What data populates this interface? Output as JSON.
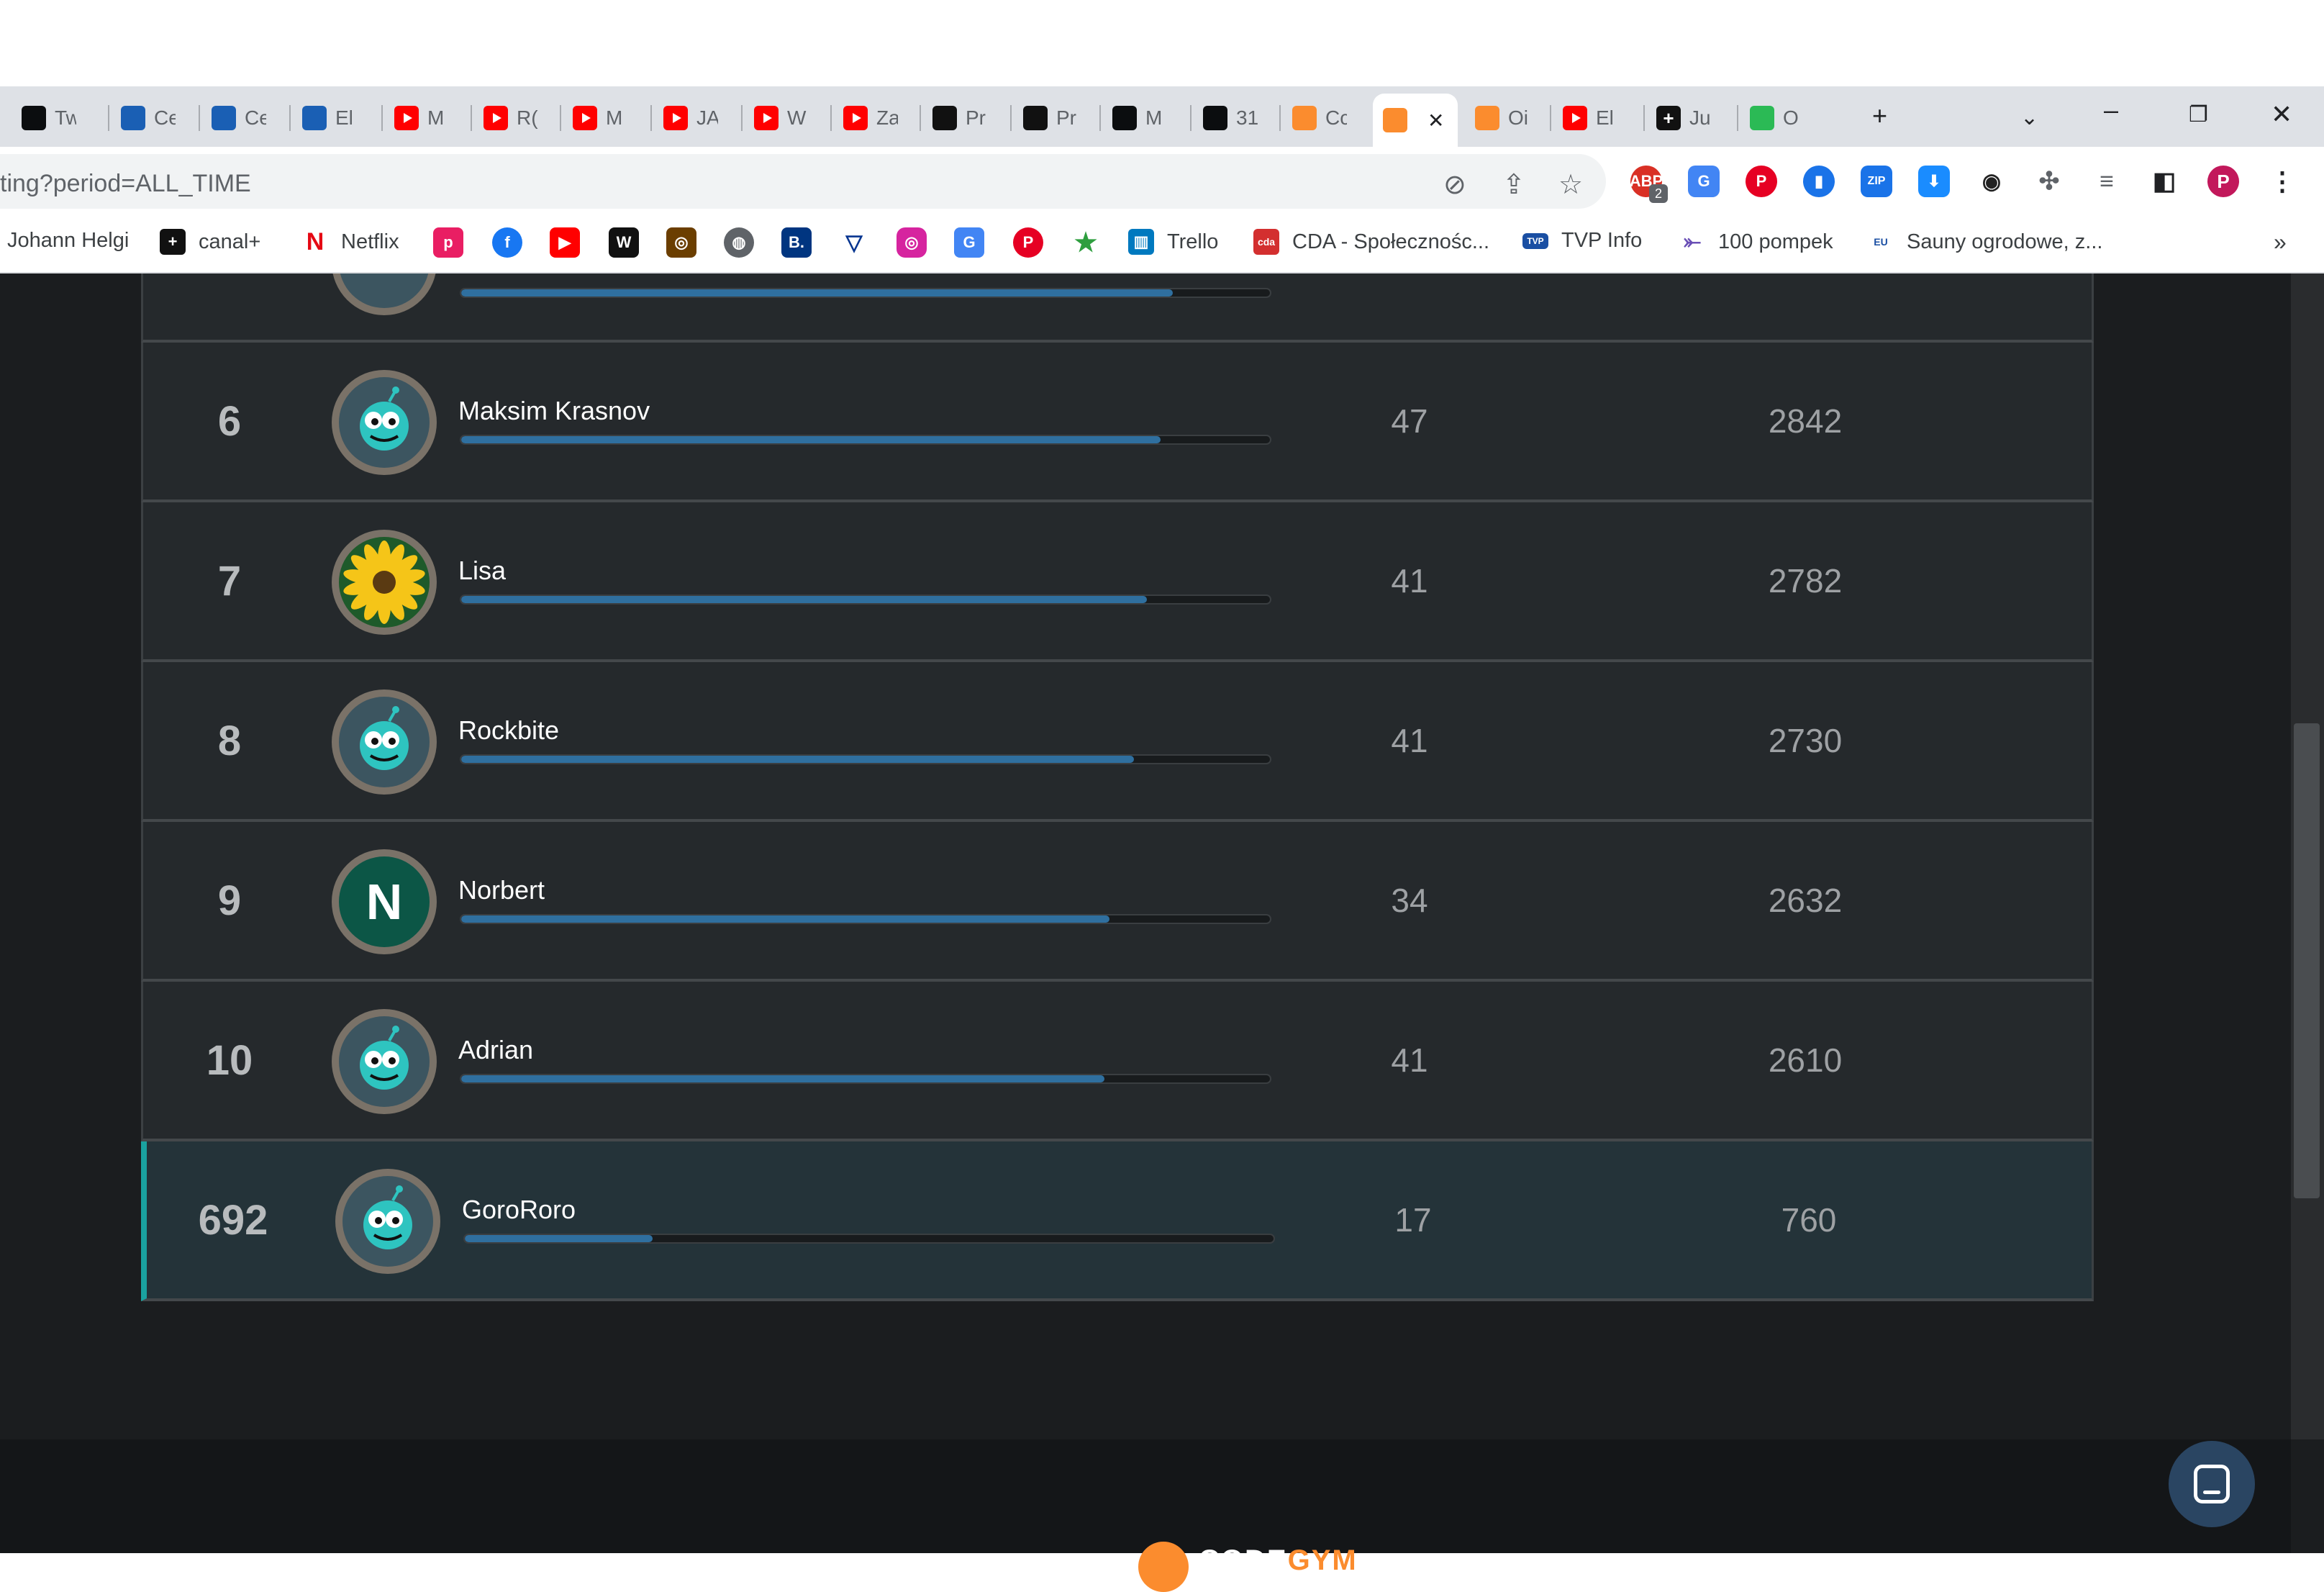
{
  "browser": {
    "tabs": [
      {
        "title": "Tw",
        "icon": "codegym-dark-icon"
      },
      {
        "title": "Ce",
        "icon": "magnet-icon"
      },
      {
        "title": "Ce",
        "icon": "magnet-icon"
      },
      {
        "title": "El",
        "icon": "magnet-icon"
      },
      {
        "title": "M",
        "icon": "youtube-icon"
      },
      {
        "title": "R(",
        "icon": "youtube-icon"
      },
      {
        "title": "M",
        "icon": "youtube-icon"
      },
      {
        "title": "JA",
        "icon": "youtube-icon"
      },
      {
        "title": "W",
        "icon": "youtube-icon"
      },
      {
        "title": "Za",
        "icon": "youtube-icon"
      },
      {
        "title": "Pr",
        "icon": "square-dark-icon"
      },
      {
        "title": "Pr",
        "icon": "square-dark-icon"
      },
      {
        "title": "M",
        "icon": "codegym-dark-icon"
      },
      {
        "title": "31",
        "icon": "codegym-dark-icon"
      },
      {
        "title": "Cc",
        "icon": "codegym-orange-icon"
      },
      {
        "title": "",
        "icon": "codegym-orange-icon",
        "active": true
      },
      {
        "title": "Oi",
        "icon": "codegym-orange-icon"
      },
      {
        "title": "El",
        "icon": "youtube-icon"
      },
      {
        "title": "Ju",
        "icon": "plus-dark-icon"
      },
      {
        "title": "O",
        "icon": "green-leaf-icon"
      }
    ],
    "url": "ting?period=ALL_TIME",
    "profile_initial": "P",
    "ext_badge": "2",
    "bookmarks": [
      {
        "label": "Johann Helgi"
      },
      {
        "label": "canal+"
      },
      {
        "label": "Netflix"
      },
      {
        "label": "Trello"
      },
      {
        "label": "CDA - Społecznośc..."
      },
      {
        "label": "TVP Info"
      },
      {
        "label": "100 pompek"
      },
      {
        "label": "Sauny ogrodowe, z..."
      }
    ],
    "bookmarks_more": "»"
  },
  "leaderboard": {
    "rows": [
      {
        "rank": "6",
        "name": "Maksim Krasnov",
        "solved": "47",
        "score": "2842",
        "progress": 0.865,
        "avatar": "robot"
      },
      {
        "rank": "7",
        "name": "Lisa",
        "solved": "41",
        "score": "2782",
        "progress": 0.848,
        "avatar": "flower"
      },
      {
        "rank": "8",
        "name": "Rockbite",
        "solved": "41",
        "score": "2730",
        "progress": 0.832,
        "avatar": "robot"
      },
      {
        "rank": "9",
        "name": "Norbert",
        "solved": "34",
        "score": "2632",
        "progress": 0.802,
        "avatar": "letter",
        "initial": "N"
      },
      {
        "rank": "10",
        "name": "Adrian",
        "solved": "41",
        "score": "2610",
        "progress": 0.795,
        "avatar": "robot"
      },
      {
        "rank": "692",
        "name": "GoroRoro",
        "solved": "17",
        "score": "760",
        "progress": 0.232,
        "avatar": "robot",
        "highlight": true
      }
    ],
    "partial_first_row_progress": 0.88
  },
  "footer": {
    "logo_part1": "CODE",
    "logo_part2": "GYM"
  },
  "colors": {
    "page_bg": "#1b1d1f",
    "row_bg": "#25292c",
    "highlight_bg": "#243339",
    "accent": "#1aa2a0",
    "progress": "#2f6f9f",
    "brand_orange": "#fb8c2e"
  }
}
